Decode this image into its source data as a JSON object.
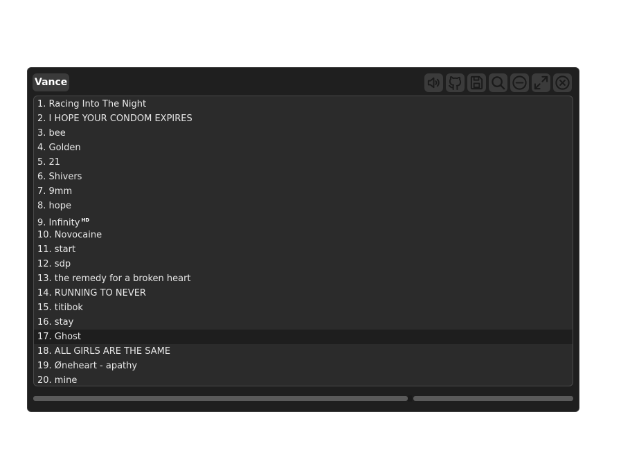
{
  "window": {
    "title": "Vance"
  },
  "toolbar": {
    "buttons": [
      {
        "name": "volume-icon"
      },
      {
        "name": "github-icon"
      },
      {
        "name": "save-icon"
      },
      {
        "name": "search-icon"
      },
      {
        "name": "minimize-icon"
      },
      {
        "name": "maximize-icon"
      },
      {
        "name": "close-icon"
      }
    ]
  },
  "playlist": {
    "selected_index": 16,
    "items": [
      {
        "label": "1. Racing Into The Night"
      },
      {
        "label": "2. I HOPE YOUR CONDOM EXPIRES"
      },
      {
        "label": "3. bee"
      },
      {
        "label": "4. Golden"
      },
      {
        "label": "5. 21"
      },
      {
        "label": "6. Shivers"
      },
      {
        "label": "7. 9mm"
      },
      {
        "label": "8. hope"
      },
      {
        "label": "9. Infinity",
        "badge": "HD"
      },
      {
        "label": "10. Novocaine"
      },
      {
        "label": "11. start"
      },
      {
        "label": "12. sdp"
      },
      {
        "label": "13. the remedy for a broken heart"
      },
      {
        "label": "14. RUNNING TO NEVER"
      },
      {
        "label": "15. titibok"
      },
      {
        "label": "16. stay"
      },
      {
        "label": "17. Ghost"
      },
      {
        "label": "18. ALL GIRLS ARE THE SAME"
      },
      {
        "label": "19. Øneheart - apathy"
      },
      {
        "label": "20. mine"
      }
    ]
  },
  "colors": {
    "window_bg": "#1f1f1f",
    "list_bg": "#2b2b2b",
    "selected_row": "#1e1e1e",
    "text": "#e8e8e8"
  }
}
